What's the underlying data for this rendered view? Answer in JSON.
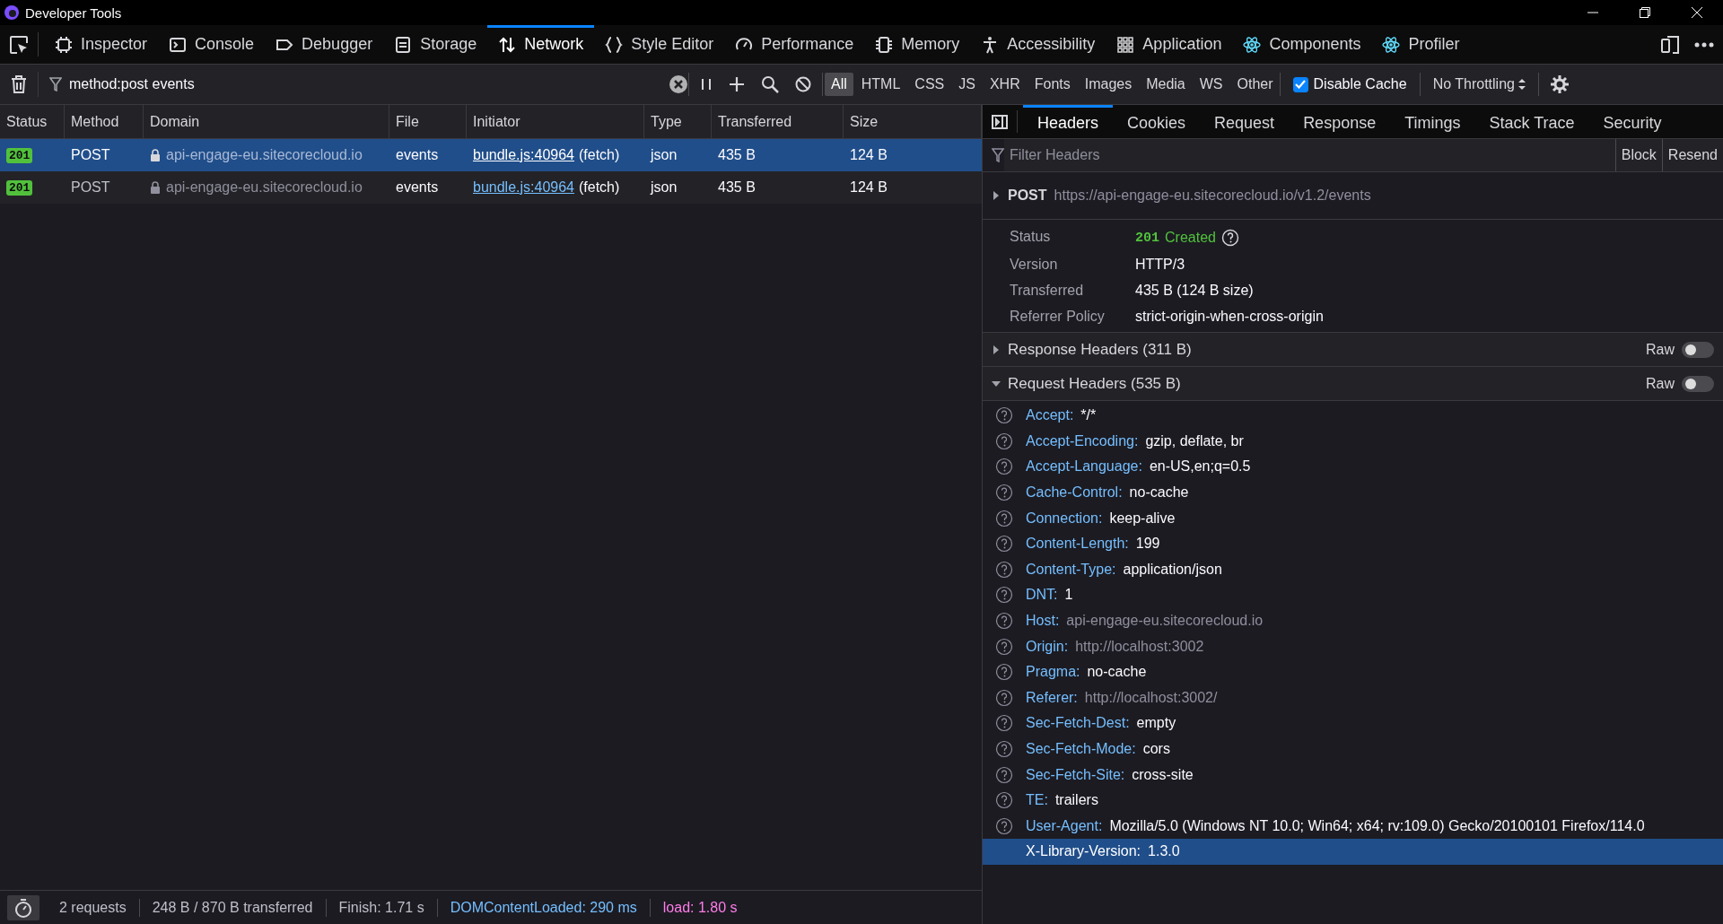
{
  "window": {
    "title": "Developer Tools"
  },
  "toolbox_tabs": [
    {
      "label": "Inspector",
      "selected": false
    },
    {
      "label": "Console",
      "selected": false
    },
    {
      "label": "Debugger",
      "selected": false
    },
    {
      "label": "Storage",
      "selected": false
    },
    {
      "label": "Network",
      "selected": true
    },
    {
      "label": "Style Editor",
      "selected": false
    },
    {
      "label": "Performance",
      "selected": false
    },
    {
      "label": "Memory",
      "selected": false
    },
    {
      "label": "Accessibility",
      "selected": false
    },
    {
      "label": "Application",
      "selected": false
    },
    {
      "label": "Components",
      "selected": false
    },
    {
      "label": "Profiler",
      "selected": false
    }
  ],
  "request_filter": {
    "value": "method:post events"
  },
  "type_filters": [
    {
      "label": "All",
      "selected": true
    },
    {
      "label": "HTML",
      "selected": false
    },
    {
      "label": "CSS",
      "selected": false
    },
    {
      "label": "JS",
      "selected": false
    },
    {
      "label": "XHR",
      "selected": false
    },
    {
      "label": "Fonts",
      "selected": false
    },
    {
      "label": "Images",
      "selected": false
    },
    {
      "label": "Media",
      "selected": false
    },
    {
      "label": "WS",
      "selected": false
    },
    {
      "label": "Other",
      "selected": false
    }
  ],
  "disable_cache": {
    "label": "Disable Cache",
    "checked": true
  },
  "throttling": {
    "label": "No Throttling"
  },
  "table": {
    "columns": [
      "Status",
      "Method",
      "Domain",
      "File",
      "Initiator",
      "Type",
      "Transferred",
      "Size"
    ],
    "rows": [
      {
        "status": "201",
        "method": "POST",
        "domain": "api-engage-eu.sitecorecloud.io",
        "file": "events",
        "initiator": "bundle.js:40964",
        "cause": "(fetch)",
        "type": "json",
        "transferred": "435 B",
        "size": "124 B",
        "selected": true
      },
      {
        "status": "201",
        "method": "POST",
        "domain": "api-engage-eu.sitecorecloud.io",
        "file": "events",
        "initiator": "bundle.js:40964",
        "cause": "(fetch)",
        "type": "json",
        "transferred": "435 B",
        "size": "124 B",
        "selected": false
      }
    ]
  },
  "details": {
    "tabs": [
      {
        "label": "Headers",
        "selected": true
      },
      {
        "label": "Cookies",
        "selected": false
      },
      {
        "label": "Request",
        "selected": false
      },
      {
        "label": "Response",
        "selected": false
      },
      {
        "label": "Timings",
        "selected": false
      },
      {
        "label": "Stack Trace",
        "selected": false
      },
      {
        "label": "Security",
        "selected": false
      }
    ],
    "filter": {
      "placeholder": "Filter Headers"
    },
    "actions": [
      "Block",
      "Resend"
    ],
    "request_line": {
      "method": "POST",
      "url": "https://api-engage-eu.sitecorecloud.io/v1.2/events",
      "expanded": false
    },
    "status": {
      "label": "Status",
      "code": "201",
      "text": "Created"
    },
    "summary": [
      {
        "label": "Version",
        "value": "HTTP/3"
      },
      {
        "label": "Transferred",
        "value": "435 B (124 B size)"
      },
      {
        "label": "Referrer Policy",
        "value": "strict-origin-when-cross-origin"
      }
    ],
    "sections": [
      {
        "title": "Response Headers (311 B)",
        "expanded": false,
        "raw_label": "Raw",
        "raw": false
      },
      {
        "title": "Request Headers (535 B)",
        "expanded": true,
        "raw_label": "Raw",
        "raw": false
      }
    ],
    "request_headers": [
      {
        "name": "Accept:",
        "value": "*/*",
        "blurred": false,
        "selected": false
      },
      {
        "name": "Accept-Encoding:",
        "value": "gzip, deflate, br",
        "blurred": false,
        "selected": false
      },
      {
        "name": "Accept-Language:",
        "value": "en-US,en;q=0.5",
        "blurred": false,
        "selected": false
      },
      {
        "name": "Cache-Control:",
        "value": "no-cache",
        "blurred": false,
        "selected": false
      },
      {
        "name": "Connection:",
        "value": "keep-alive",
        "blurred": false,
        "selected": false
      },
      {
        "name": "Content-Length:",
        "value": "199",
        "blurred": false,
        "selected": false
      },
      {
        "name": "Content-Type:",
        "value": "application/json",
        "blurred": false,
        "selected": false
      },
      {
        "name": "DNT:",
        "value": "1",
        "blurred": false,
        "selected": false
      },
      {
        "name": "Host:",
        "value": "api-engage-eu.sitecorecloud.io",
        "blurred": true,
        "selected": false
      },
      {
        "name": "Origin:",
        "value": "http://localhost:3002",
        "blurred": true,
        "selected": false
      },
      {
        "name": "Pragma:",
        "value": "no-cache",
        "blurred": false,
        "selected": false
      },
      {
        "name": "Referer:",
        "value": "http://localhost:3002/",
        "blurred": true,
        "selected": false
      },
      {
        "name": "Sec-Fetch-Dest:",
        "value": "empty",
        "blurred": false,
        "selected": false
      },
      {
        "name": "Sec-Fetch-Mode:",
        "value": "cors",
        "blurred": false,
        "selected": false
      },
      {
        "name": "Sec-Fetch-Site:",
        "value": "cross-site",
        "blurred": false,
        "selected": false
      },
      {
        "name": "TE:",
        "value": "trailers",
        "blurred": false,
        "selected": false
      },
      {
        "name": "User-Agent:",
        "value": "Mozilla/5.0 (Windows NT 10.0; Win64; x64; rv:109.0) Gecko/20100101 Firefox/114.0",
        "blurred": false,
        "selected": false
      },
      {
        "name": "X-Library-Version:",
        "value": "1.3.0",
        "blurred": false,
        "selected": true
      }
    ]
  },
  "status_bar": [
    {
      "text": "2 requests",
      "kind": "plain"
    },
    {
      "text": "248 B / 870 B transferred",
      "kind": "plain"
    },
    {
      "text": "Finish: 1.71 s",
      "kind": "plain"
    },
    {
      "text": "DOMContentLoaded: 290 ms",
      "kind": "dom"
    },
    {
      "text": "load: 1.80 s",
      "kind": "load"
    }
  ]
}
